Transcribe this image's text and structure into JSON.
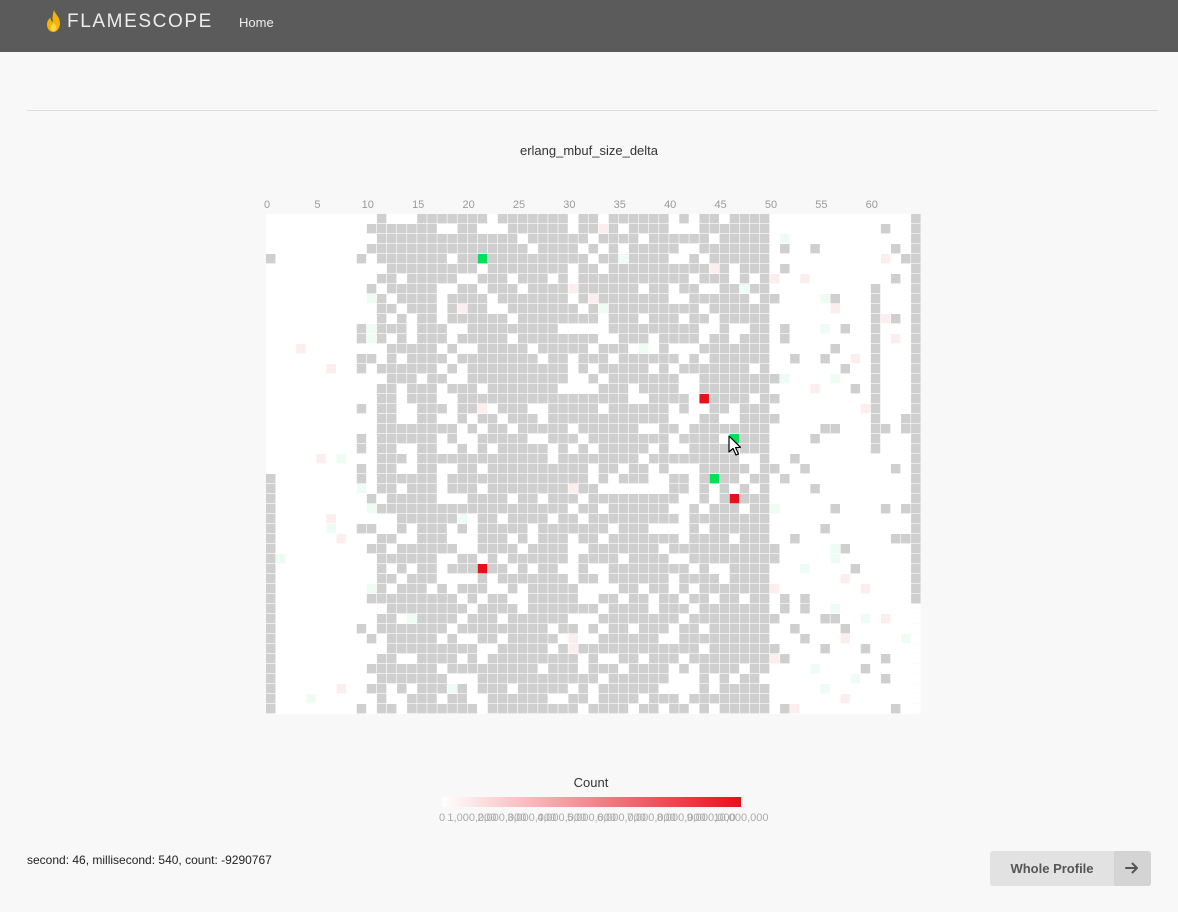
{
  "app": {
    "logo_text": "FLAMESCOPE",
    "nav": {
      "home_label": "Home"
    },
    "colors": {
      "navbar_bg": "#5b5b5b",
      "flame": "#f5b400"
    }
  },
  "heatmap": {
    "title": "erlang_mbuf_size_delta",
    "columns": 65,
    "rows": 50,
    "x_ticks": [
      "0",
      "5",
      "10",
      "15",
      "20",
      "25",
      "30",
      "35",
      "40",
      "45",
      "50",
      "55",
      "60"
    ],
    "highlighted_cells": [
      {
        "second": 21,
        "row": 4,
        "color": "#00e05a"
      },
      {
        "second": 43,
        "row": 18,
        "color": "#e8101c"
      },
      {
        "second": 46,
        "row": 22,
        "color": "#00e05a"
      },
      {
        "second": 44,
        "row": 26,
        "color": "#00e05a"
      },
      {
        "second": 46,
        "row": 28,
        "color": "#e8101c"
      },
      {
        "second": 21,
        "row": 35,
        "color": "#e8101c"
      }
    ],
    "colors": {
      "filled": "#cfcfcf",
      "empty": "#ffffff",
      "hover": "#00e05a",
      "max": "#e8101c"
    }
  },
  "legend": {
    "title": "Count",
    "ticks": [
      "0",
      "1,000,000",
      "2,000,000",
      "3,000,000",
      "4,000,000",
      "5,000,000",
      "6,000,000",
      "7,000,000",
      "8,000,000",
      "9,000,000",
      "10,000,000"
    ],
    "color_low": "#ffffff",
    "color_high": "#e8101c"
  },
  "status": {
    "text": "second: 46, millisecond: 540, count: -9290767"
  },
  "actions": {
    "whole_profile_label": "Whole Profile",
    "whole_profile_icon": "arrow-right-icon"
  }
}
